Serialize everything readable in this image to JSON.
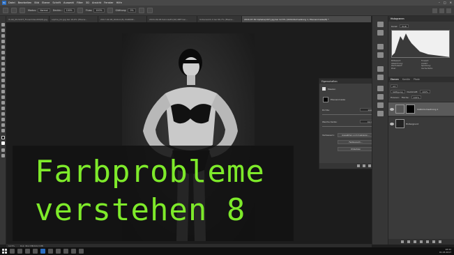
{
  "menubar": {
    "logo": "Ps",
    "items": [
      "Datei",
      "Bearbeiten",
      "Bild",
      "Ebene",
      "Schrift",
      "Auswahl",
      "Filter",
      "3D",
      "Ansicht",
      "Fenster",
      "Hilfe"
    ]
  },
  "options": {
    "mode_label": "Modus:",
    "mode_value": "Normal",
    "opacity_label": "Deckkr.:",
    "opacity_value": "100%",
    "flow_label": "Fluss:",
    "flow_value": "100%",
    "smoothing_label": "Glättung:",
    "smoothing_value": "0%"
  },
  "tabs": [
    {
      "label": "IS-09_09.SCOT_Flussmilieu200(8).jpg",
      "active": false
    },
    {
      "label": "sophie_01.jpg bei 16,6% (Ebene...",
      "active": false
    },
    {
      "label": "2017-02-06_Ribbon(8), RGB/8#...",
      "active": false
    },
    {
      "label": "2016-09-06 Kalonis#1(92).NEF bei...",
      "active": false
    },
    {
      "label": "Unbenannt-1 bei 66,7% (Ebene...",
      "active": false
    },
    {
      "label": "2016-07-30 Ophelia(197).jpg bei 12,5% (Vollbildumsetzung 1, Ebenenmaske/8) *",
      "active": true
    }
  ],
  "properties": {
    "title": "Eigenschaften",
    "subtitle": "Masken",
    "mask_label": "Ebenenmaske",
    "density_label": "Dichte:",
    "density_value": "100%",
    "feather_label": "Weiche Kante:",
    "feather_value": "0,0 Px",
    "refine_label": "Verbessern:",
    "btn_select_mask": "Auswählen und maskieren...",
    "btn_color_range": "Farbbereich...",
    "btn_invert": "Umkehren"
  },
  "histogram": {
    "tabs": [
      "Histogramm"
    ],
    "channel_label": "Kanal:",
    "channel_value": "RGB",
    "source_label": "Quelle:",
    "source_value": "Gesamtes Bild",
    "stats": [
      "Mittelwert:",
      "Tonwert:",
      "Abweichung:",
      "Anzahl:",
      "Zentralwert:",
      "Spreizung:",
      "Pixel:",
      "Cache-Stufe:"
    ]
  },
  "layers": {
    "tabs": [
      "Ebenen",
      "Kanäle",
      "Pfade"
    ],
    "kind_label": "Art",
    "blend_value": "Sättigung",
    "opacity_label": "Deckkraft:",
    "opacity_value": "100%",
    "lock_label": "Fixieren:",
    "fill_label": "Fläche:",
    "fill_value": "100%",
    "items": [
      {
        "name": "Vollbildumsetzung 1"
      },
      {
        "name": "Hintergrund"
      }
    ]
  },
  "status": {
    "zoom": "12,5%",
    "doc": "Dok: 96,2 MB/144,3 MB"
  },
  "taskbar": {
    "time": "18:32",
    "date": "01.03.2017"
  },
  "overlay": {
    "line1": "Farbprobleme",
    "line2": "verstehen 8",
    "color": "#7eea2a"
  }
}
